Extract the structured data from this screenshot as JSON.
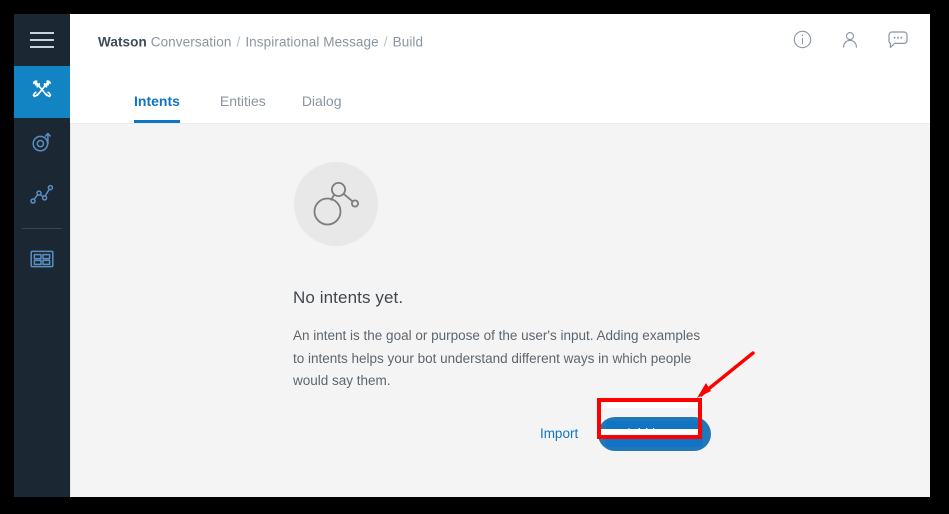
{
  "app": {
    "name": "Watson Conversation",
    "background_color": "#f4f4f4",
    "accent_color": "#1274c4",
    "sidebar_color": "#1b2733",
    "annotation_color": "#ff0000"
  },
  "breadcrumb": {
    "brand": "Watson",
    "product": "Conversation",
    "separator": "/",
    "workspace": "Inspirational Message",
    "section": "Build"
  },
  "sidebar": {
    "items": [
      {
        "name": "menu-toggle",
        "icon": "hamburger-menu-icon",
        "active": false
      },
      {
        "name": "build-tools",
        "icon": "tools-icon",
        "active": true
      },
      {
        "name": "deploy",
        "icon": "deploy-arrow-icon",
        "active": false
      },
      {
        "name": "improve",
        "icon": "analytics-line-icon",
        "active": false
      },
      {
        "name": "dashboard",
        "icon": "grid-dashboard-icon",
        "active": false
      }
    ]
  },
  "header": {
    "actions": [
      {
        "name": "info",
        "icon": "info-circle-icon"
      },
      {
        "name": "account",
        "icon": "user-person-icon"
      },
      {
        "name": "support-chat",
        "icon": "chat-bubble-icon"
      }
    ]
  },
  "tabs": [
    {
      "label": "Intents",
      "active": true
    },
    {
      "label": "Entities",
      "active": false
    },
    {
      "label": "Dialog",
      "active": false
    }
  ],
  "empty_state": {
    "illustration": "intent-node-graph-icon",
    "title": "No intents yet.",
    "description": "An intent is the goal or purpose of the user's input. Adding examples to intents helps your bot understand different ways in which people would say them.",
    "import_label": "Import",
    "add_intent_label": "Add intent"
  },
  "annotations": {
    "highlight_box_target": "Add intent",
    "arrow_direction": "down-left"
  }
}
